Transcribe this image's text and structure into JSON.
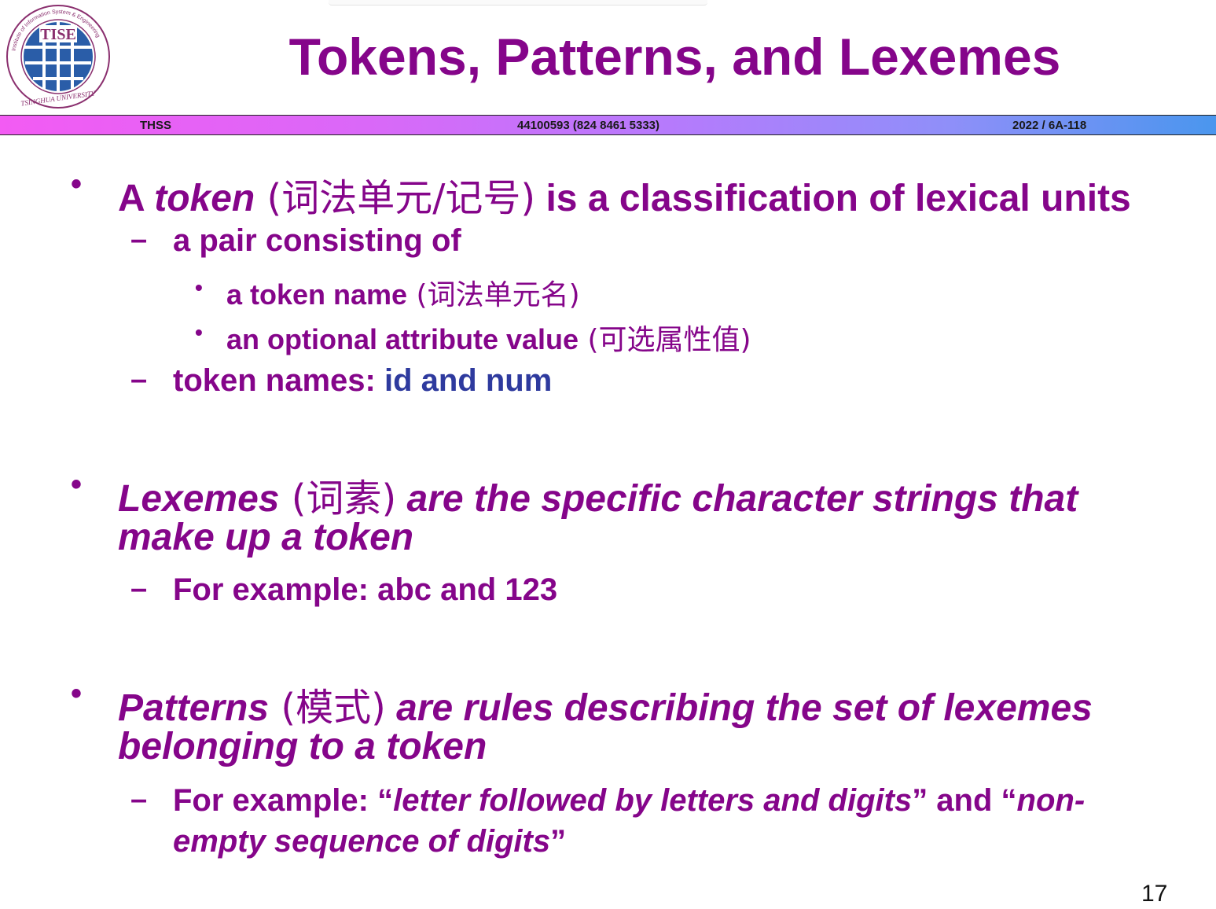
{
  "slide": {
    "title": "Tokens, Patterns, and Lexemes",
    "page_number": "17"
  },
  "logo": {
    "ring_text_top": "Institute of Information System & Engineering",
    "ring_text_bottom": "TSINGHUA UNIVERSITY",
    "center_text": "TISE"
  },
  "footer_bar": {
    "left": "THSS",
    "center": "44100593 (824 8461 5333)",
    "right": "2022 / 6A-118"
  },
  "colors": {
    "text_purple": "#85058a",
    "keyword_blue": "#2e3a9e"
  },
  "bullet1": {
    "prefix": "A ",
    "term": "token",
    "cjk": " (词法单元/记号)",
    "rest": " is a classification of lexical units",
    "sub1": "a pair consisting of",
    "sub1_items": [
      {
        "text": "a token name",
        "cjk": " (词法单元名)"
      },
      {
        "text": "an optional attribute value",
        "cjk": " (可选属性值)"
      }
    ],
    "sub2_prefix": "token names: ",
    "sub2_id": "id",
    "sub2_and": " and ",
    "sub2_num": "num"
  },
  "bullet2": {
    "term": "Lexemes",
    "cjk": " (词素)",
    "rest_line1": " are the specific character strings that",
    "line2": "make up a token",
    "sub1": "For example: abc and 123"
  },
  "bullet3": {
    "term": "Patterns",
    "cjk": " (模式)",
    "rest_line1": " are rules describing the set of lexemes",
    "line2": "belonging to a token",
    "sub_prefix": "For example: “",
    "sub_italic1": "letter followed by letters and digits",
    "sub_mid": "” and “",
    "sub_italic2_line1": "non-",
    "sub_italic2_line2": "empty sequence of digits",
    "sub_end": "”"
  }
}
